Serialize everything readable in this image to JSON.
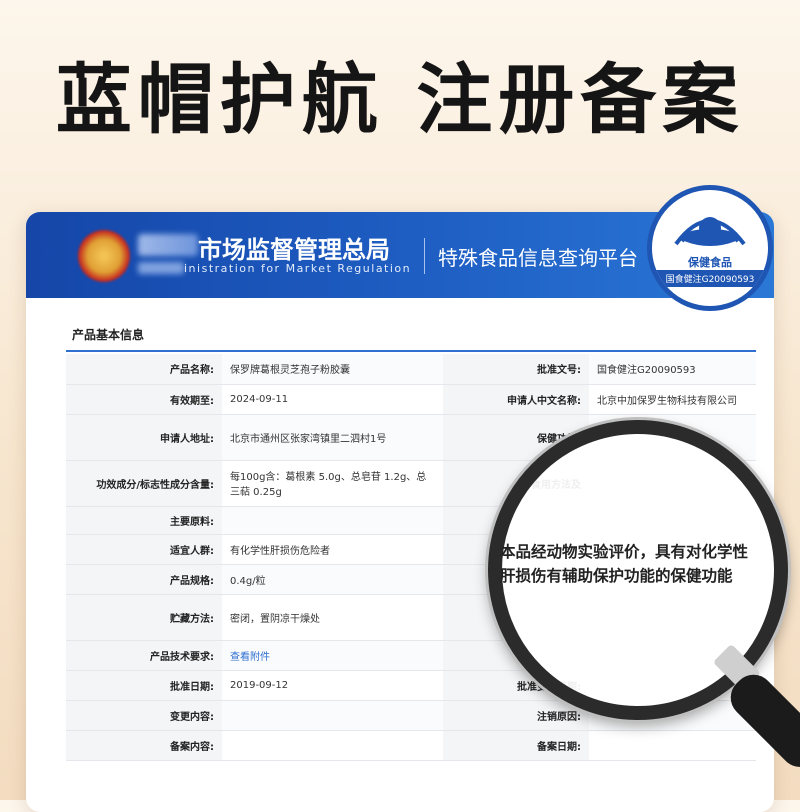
{
  "headline": "蓝帽护航 注册备案",
  "banner": {
    "agency_cn": "市场监督管理总局",
    "agency_en": "inistration for Market Regulation",
    "platform": "特殊食品信息查询平台"
  },
  "section_title": "产品基本信息",
  "rows": [
    {
      "l1": "产品名称:",
      "v1": "保罗牌葛根灵芝孢子粉胶囊",
      "l2": "批准文号:",
      "v2": "国食健注G20090593"
    },
    {
      "l1": "有效期至:",
      "v1": "2024-09-11",
      "l2": "申请人中文名称:",
      "v2": "北京中加保罗生物科技有限公司"
    },
    {
      "l1": "申请人地址:",
      "v1": "北京市通州区张家湾镇里二泗村1号",
      "l2": "保健功能:",
      "v2": ""
    },
    {
      "l1": "功效成分/标志性成分含量:",
      "v1": "每100g含：葛根素 5.0g、总皂苷 1.2g、总三萜 0.25g",
      "l2": "食用方法及",
      "v2": ""
    },
    {
      "l1": "主要原料:",
      "v1": "",
      "l2": "",
      "v2": ""
    },
    {
      "l1": "适宜人群:",
      "v1": "有化学性肝损伤危险者",
      "l2": "",
      "v2": ""
    },
    {
      "l1": "产品规格:",
      "v1": "0.4g/粒",
      "l2": "",
      "v2": ""
    },
    {
      "l1": "贮藏方法:",
      "v1": "密闭，置阴凉干燥处",
      "l2": "",
      "v2": ""
    },
    {
      "l1": "产品技术要求:",
      "v1": "查看附件",
      "l2": "",
      "v2": ""
    },
    {
      "l1": "批准日期:",
      "v1": "2019-09-12",
      "l2": "批准变更日期:",
      "v2": ""
    },
    {
      "l1": "变更内容:",
      "v1": "",
      "l2": "注销原因:",
      "v2": ""
    },
    {
      "l1": "备案内容:",
      "v1": "",
      "l2": "备案日期:",
      "v2": ""
    }
  ],
  "badge": {
    "name": "保健食品",
    "code": "国食健注G20090593"
  },
  "magnified": {
    "line1": "本品经动物实验评价，具有对化学性",
    "line2": "肝损伤有辅助保护功能的保健功能"
  },
  "colors": {
    "banner_blue": "#1546a8",
    "badge_blue": "#1f56b3",
    "link_blue": "#2f6fcf"
  }
}
